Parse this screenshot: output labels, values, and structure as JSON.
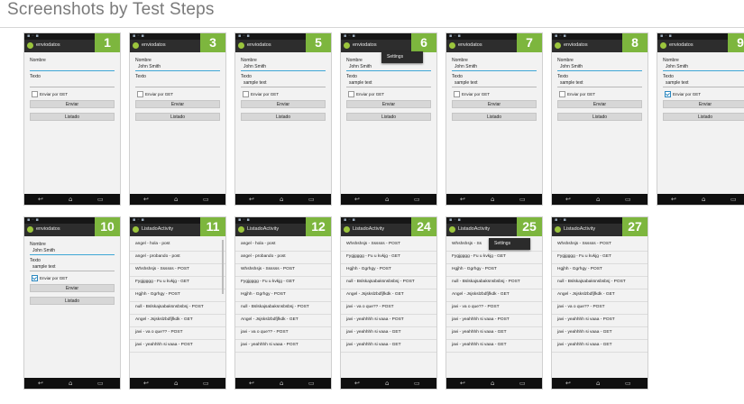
{
  "page_title": "Screenshots by Test Steps",
  "nav_icons": {
    "back": "back-arrow-icon",
    "home": "home-icon",
    "recents": "recent-apps-icon",
    "app": "android-app-icon"
  },
  "screens": [
    {
      "step": "1",
      "title": "enviodatos",
      "type": "form_blank",
      "form": {
        "nombre_label": "Nombre",
        "texto_label": "Texto",
        "checkbox_label": "Enviar por GET",
        "enviar_label": "Enviar",
        "listado_label": "Listado"
      }
    },
    {
      "step": "3",
      "title": "enviodatos",
      "type": "form",
      "form": {
        "nombre_label": "Nombre",
        "nombre_value": "John Smith",
        "texto_label": "Texto",
        "texto_value": "",
        "checkbox_label": "Enviar por GET",
        "checked": false,
        "enviar_label": "Enviar",
        "listado_label": "Listado"
      }
    },
    {
      "step": "5",
      "title": "enviodatos",
      "type": "form",
      "form": {
        "nombre_label": "Nombre",
        "nombre_value": "John Smith",
        "texto_label": "Texto",
        "texto_value": "sample text",
        "checkbox_label": "Enviar por GET",
        "checked": false,
        "enviar_label": "Enviar",
        "listado_label": "Listado"
      }
    },
    {
      "step": "6",
      "title": "enviodatos",
      "type": "form",
      "menu": "Settings",
      "form": {
        "nombre_label": "Nombre",
        "nombre_value": "John Smith",
        "texto_label": "Texto",
        "texto_value": "sample text",
        "checkbox_label": "Enviar por GET",
        "checked": false,
        "enviar_label": "Enviar",
        "listado_label": "Listado"
      }
    },
    {
      "step": "7",
      "title": "enviodatos",
      "type": "form",
      "form": {
        "nombre_label": "Nombre",
        "nombre_value": "John Smith",
        "texto_label": "Texto",
        "texto_value": "sample text",
        "checkbox_label": "Enviar por GET",
        "checked": false,
        "enviar_label": "Enviar",
        "listado_label": "Listado"
      }
    },
    {
      "step": "8",
      "title": "enviodatos",
      "type": "form",
      "form": {
        "nombre_label": "Nombre",
        "nombre_value": "John Smith",
        "texto_label": "Texto",
        "texto_value": "sample text",
        "checkbox_label": "Enviar por GET",
        "checked": false,
        "enviar_label": "Enviar",
        "listado_label": "Listado"
      }
    },
    {
      "step": "9",
      "title": "enviodatos",
      "type": "form",
      "form": {
        "nombre_label": "Nombre",
        "nombre_value": "John Smith",
        "texto_label": "Texto",
        "texto_value": "sample text",
        "checkbox_label": "Enviar por GET",
        "checked": true,
        "enviar_label": "Enviar",
        "listado_label": "Listado"
      }
    },
    {
      "step": "10",
      "title": "enviodatos",
      "type": "form",
      "form": {
        "nombre_label": "Nombre",
        "nombre_value": "John Smith",
        "texto_label": "Texto",
        "texto_value": "sample text",
        "checkbox_label": "Enviar por GET",
        "checked": true,
        "enviar_label": "Enviar",
        "listado_label": "Listado"
      }
    },
    {
      "step": "11",
      "title": "ListadoActivity",
      "type": "list",
      "scrollbar": true,
      "items": [
        "angel - hola - post",
        "angel - probando - post",
        "Whshshsjs - Ssssss - POST",
        "Fygjgggg - Fu u kvkjg - GET",
        "Hgjhh - Ggrhgy - POST",
        "null - Bslskajsabaksnsbsbsj - POST",
        "Angel - Jsjskslzbdfjfkdk    - GET",
        "javi - va o que?? - POST",
        "javi - yeahhhh si vaaa - POST"
      ]
    },
    {
      "step": "12",
      "title": "ListadoActivity",
      "type": "list",
      "items": [
        "angel - hola - post",
        "angel - probando - post",
        "Whshshsjs - Ssssss - POST",
        "Fygjgggg - Fu u kvkjg - GET",
        "Hgjhh - Ggrhgy - POST",
        "null - Bslskajsabaksnsbsbsj - POST",
        "Angel - Jsjskslzbdfjfkdk    - GET",
        "javi - va o que?? - POST",
        "javi - yeahhhh si vaaa - POST"
      ]
    },
    {
      "step": "24",
      "title": "ListadoActivity",
      "type": "list",
      "items": [
        "Whshshsjs - Ssssss - POST",
        "Fygjgggg - Fu u kvkjg - GET",
        "Hgjhh - Ggrhgy - POST",
        "null - Bslskajsabaksnsbsbsj - POST",
        "Angel - Jsjskslzbdfjfkdk    - GET",
        "javi - va o que?? - POST",
        "javi - yeahhhh si vaaa - POST",
        "javi - yeahhhh si vaaa - GET",
        "javi - yeahhhh si vaaa - GET"
      ]
    },
    {
      "step": "25",
      "title": "ListadoActivity",
      "type": "list",
      "menu": "Settings",
      "items": [
        "Whshshsjs - Ss",
        "Fygjgggg - Fu u kvkjg - GET",
        "Hgjhh - Ggrhgy - POST",
        "null - Bslskajsabaksnsbsbsj - POST",
        "Angel - Jsjskslzbdfjfkdk    - GET",
        "javi - va o que?? - POST",
        "javi - yeahhhh si vaaa - POST",
        "javi - yeahhhh si vaaa - GET",
        "javi - yeahhhh si vaaa - GET"
      ]
    },
    {
      "step": "27",
      "title": "ListadoActivity",
      "type": "list",
      "items": [
        "Whshshsjs - Ssssss - POST",
        "Fygjgggg - Fu u kvkjg - GET",
        "Hgjhh - Ggrhgy - POST",
        "null - Bslskajsabaksnsbsbsj - POST",
        "Angel - Jsjskslzbdfjfkdk    - GET",
        "javi - va o que?? - POST",
        "javi - yeahhhh si vaaa - POST",
        "javi - yeahhhh si vaaa - GET",
        "javi - yeahhhh si vaaa - GET"
      ]
    }
  ],
  "colors": {
    "badge": "#7db63e",
    "actionbar": "#2d2d2d",
    "screen_bg": "#f2f2f2",
    "underline": "#3fa7d6",
    "heading": "#7a7a7a"
  }
}
